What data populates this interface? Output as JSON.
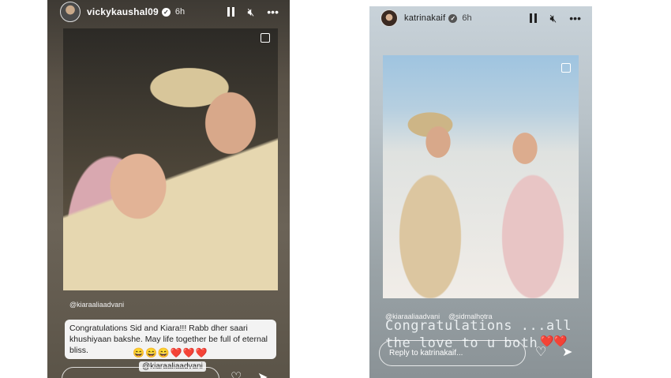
{
  "left_story": {
    "username": "vickykaushal09",
    "time_ago": "6h",
    "mention_top": "@kiaraaliaadvani",
    "caption": "Congratulations Sid and Kiara!!! Rabb dher saari khushiyaan bakshe. May life together be full of eternal bliss.",
    "emojis": "😄😄😄❤️❤️❤️",
    "mention_bottom": "@kiaraaliaadvani",
    "reply_placeholder": ""
  },
  "right_story": {
    "username": "katrinakaif",
    "time_ago": "6h",
    "mention_1": "@kiaraaliaadvani",
    "mention_2": "@sidmalhotra",
    "text": "Congratulations ...all the love to u both",
    "hearts": "❤️❤️",
    "reply_placeholder": "Reply to katrinakaif..."
  },
  "icons": {
    "verified": "✓",
    "mute": "🔇",
    "more": "•••",
    "heart": "♡",
    "send": "➤"
  }
}
